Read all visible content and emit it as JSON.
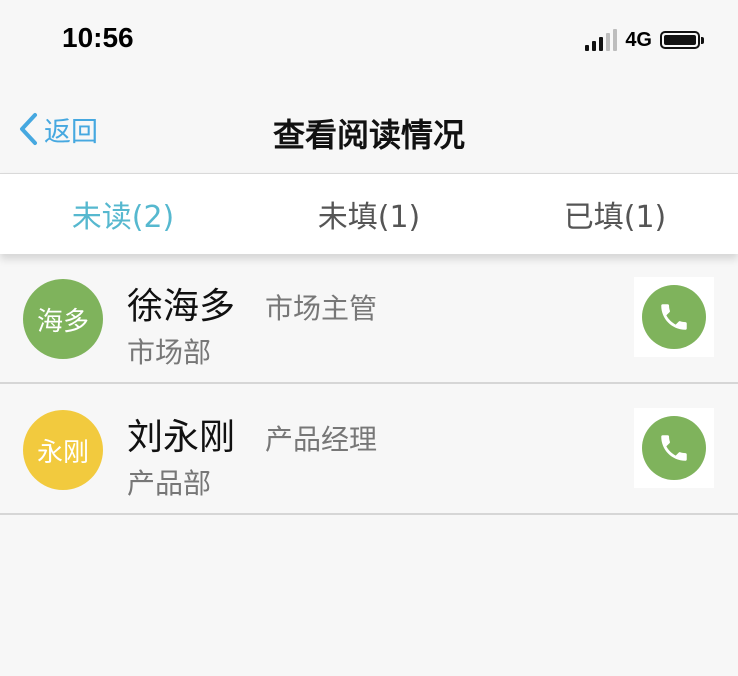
{
  "status_bar": {
    "time": "10:56",
    "network": "4G"
  },
  "nav": {
    "back_label": "返回",
    "title": "查看阅读情况"
  },
  "tabs": [
    {
      "label": "未读(2)",
      "active": true
    },
    {
      "label": "未填(1)",
      "active": false
    },
    {
      "label": "已填(1)",
      "active": false
    }
  ],
  "contacts": [
    {
      "avatar_text": "海多",
      "avatar_color": "#7fb35c",
      "name": "徐海多",
      "position": "市场主管",
      "department": "市场部",
      "call_icon": "phone-icon"
    },
    {
      "avatar_text": "永刚",
      "avatar_color": "#f2ca3e",
      "name": "刘永刚",
      "position": "产品经理",
      "department": "产品部",
      "call_icon": "phone-icon"
    }
  ],
  "colors": {
    "accent": "#46a8e0",
    "tab_active": "#56b8cf",
    "call_green": "#7fb35c"
  }
}
